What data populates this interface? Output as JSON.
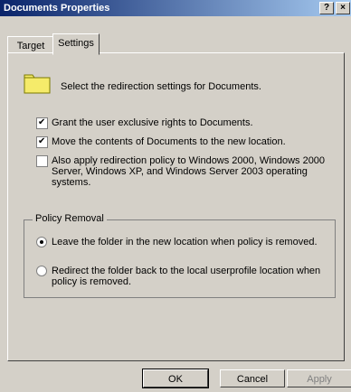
{
  "window": {
    "title": "Documents Properties",
    "help_glyph": "?",
    "close_glyph": "×"
  },
  "tabs": [
    {
      "label": "Target"
    },
    {
      "label": "Settings"
    }
  ],
  "intro": {
    "icon": "folder-icon",
    "text": "Select the redirection settings for Documents."
  },
  "options": [
    {
      "label": "Grant the user exclusive rights to Documents.",
      "checked": true
    },
    {
      "label": "Move the contents of Documents to the new location.",
      "checked": true
    },
    {
      "label_lines": [
        "Also apply redirection policy to Windows 2000, Windows 2000",
        "Server, Windows XP, and Windows Server 2003 operating",
        "systems."
      ],
      "checked": false
    }
  ],
  "policy_removal": {
    "title": "Policy Removal",
    "options": [
      {
        "label": "Leave the folder in the new location when policy is removed.",
        "selected": true
      },
      {
        "label_lines": [
          "Redirect the folder back to the local userprofile location when",
          "policy is removed."
        ],
        "selected": false
      }
    ]
  },
  "buttons": {
    "ok": "OK",
    "cancel": "Cancel",
    "apply": "Apply"
  },
  "colors": {
    "titlebar_start": "#0a246a",
    "titlebar_end": "#a6caf0",
    "dialog_bg": "#d4d0c8",
    "folder": "#f5eb6a"
  }
}
